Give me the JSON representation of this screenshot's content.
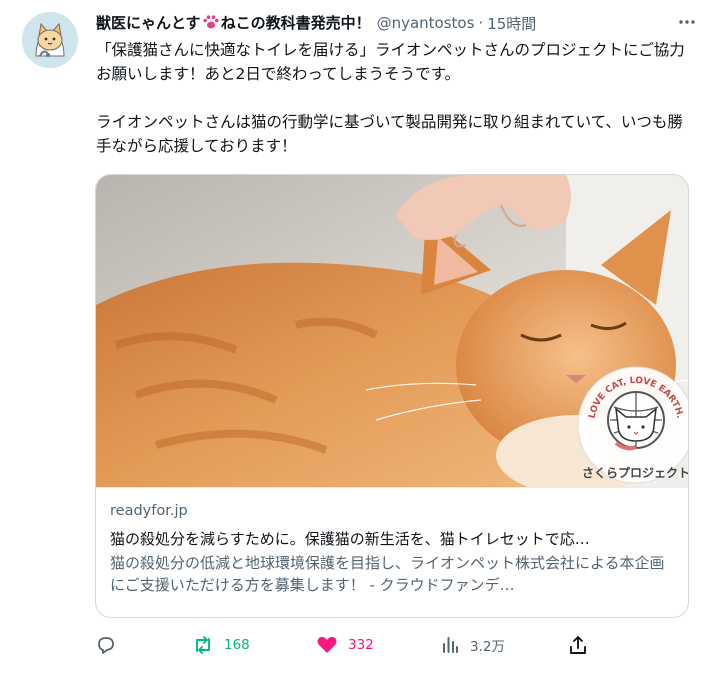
{
  "author": {
    "display_name_part1": "獣医にゃんとす",
    "display_name_part2": "ねこの教科書発売中！",
    "handle": "@nyantostos",
    "separator": "·",
    "time": "15時間"
  },
  "tweet": {
    "text": "「保護猫さんに快適なトイレを届ける」ライオンペットさんのプロジェクトにご協力お願いします！あと2日で終わってしまうそうです。\n\nライオンペットさんは猫の行動学に基づいて製品開発に取り組まれていて、いつも勝手ながら応援しております！"
  },
  "card": {
    "logo_arc_text": "LOVE CAT, LOVE EARTH.",
    "logo_caption": "さくらプロジェクト",
    "domain": "readyfor.jp",
    "title": "猫の殺処分を減らすために。保護猫の新生活を、猫トイレセットで応…",
    "description": "猫の殺処分の低減と地球環境保護を目指し、ライオンペット株式会社による本企画にご支援いただける方を募集します！ - クラウドファンデ…"
  },
  "actions": {
    "reply_count": "",
    "retweet_count": "168",
    "like_count": "332",
    "views_count": "3.2万"
  },
  "colors": {
    "retweet": "#00ba7c",
    "like": "#f91880",
    "secondary_text": "#536471",
    "border": "#cfd9de"
  },
  "icons": {
    "more": "more-dots-icon",
    "paw": "paw-icon",
    "reply": "reply-icon",
    "retweet": "retweet-icon",
    "like": "heart-icon",
    "views": "views-icon",
    "share": "share-icon"
  }
}
